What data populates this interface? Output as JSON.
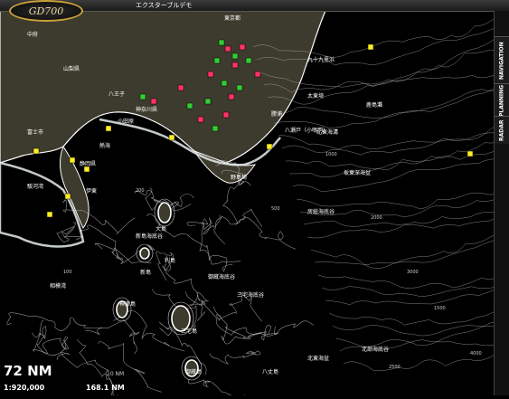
{
  "app": {
    "logo": "GD700",
    "title": "エクスターブルデモ"
  },
  "side_tabs": [
    "NAVIGATION",
    "PLANNING",
    "RADAR"
  ],
  "scale": {
    "distance": "72 NM",
    "ratio": "1:920,000",
    "range_label": "10 NM",
    "range_value": "168.1 NM"
  },
  "place_labels": [
    "中府",
    "東京都",
    "八王子",
    "山梨県",
    "静岡県",
    "神奈川県",
    "九十九里浜",
    "太東埼",
    "勝浦",
    "富士市",
    "伊東",
    "熱海",
    "小田原",
    "大島",
    "利島",
    "新島",
    "神津島",
    "三宅島",
    "御蔵島",
    "八丈島",
    "野島埼",
    "北東海溝",
    "坂東深海盆",
    "鹿島灘",
    "房総海底谷",
    "相模湾",
    "駿河湾",
    "三宅海底谷",
    "御蔵海底谷",
    "北部海底谷",
    "北東海盆",
    "新島海底谷",
    "八瀬戸（小鳴門）"
  ],
  "depth_labels": [
    "1000",
    "2000",
    "3000",
    "500",
    "1500",
    "2500",
    "200",
    "100",
    "4000"
  ],
  "colors": {
    "land": "#3d3b2d",
    "sea": "#000000",
    "contour": "#ffffff",
    "shallow": "#e6ecec",
    "marker_green": "#33cc33",
    "marker_pink": "#ff3366",
    "marker_yellow": "#ffee22",
    "logo_ring": "#c9a13a"
  }
}
